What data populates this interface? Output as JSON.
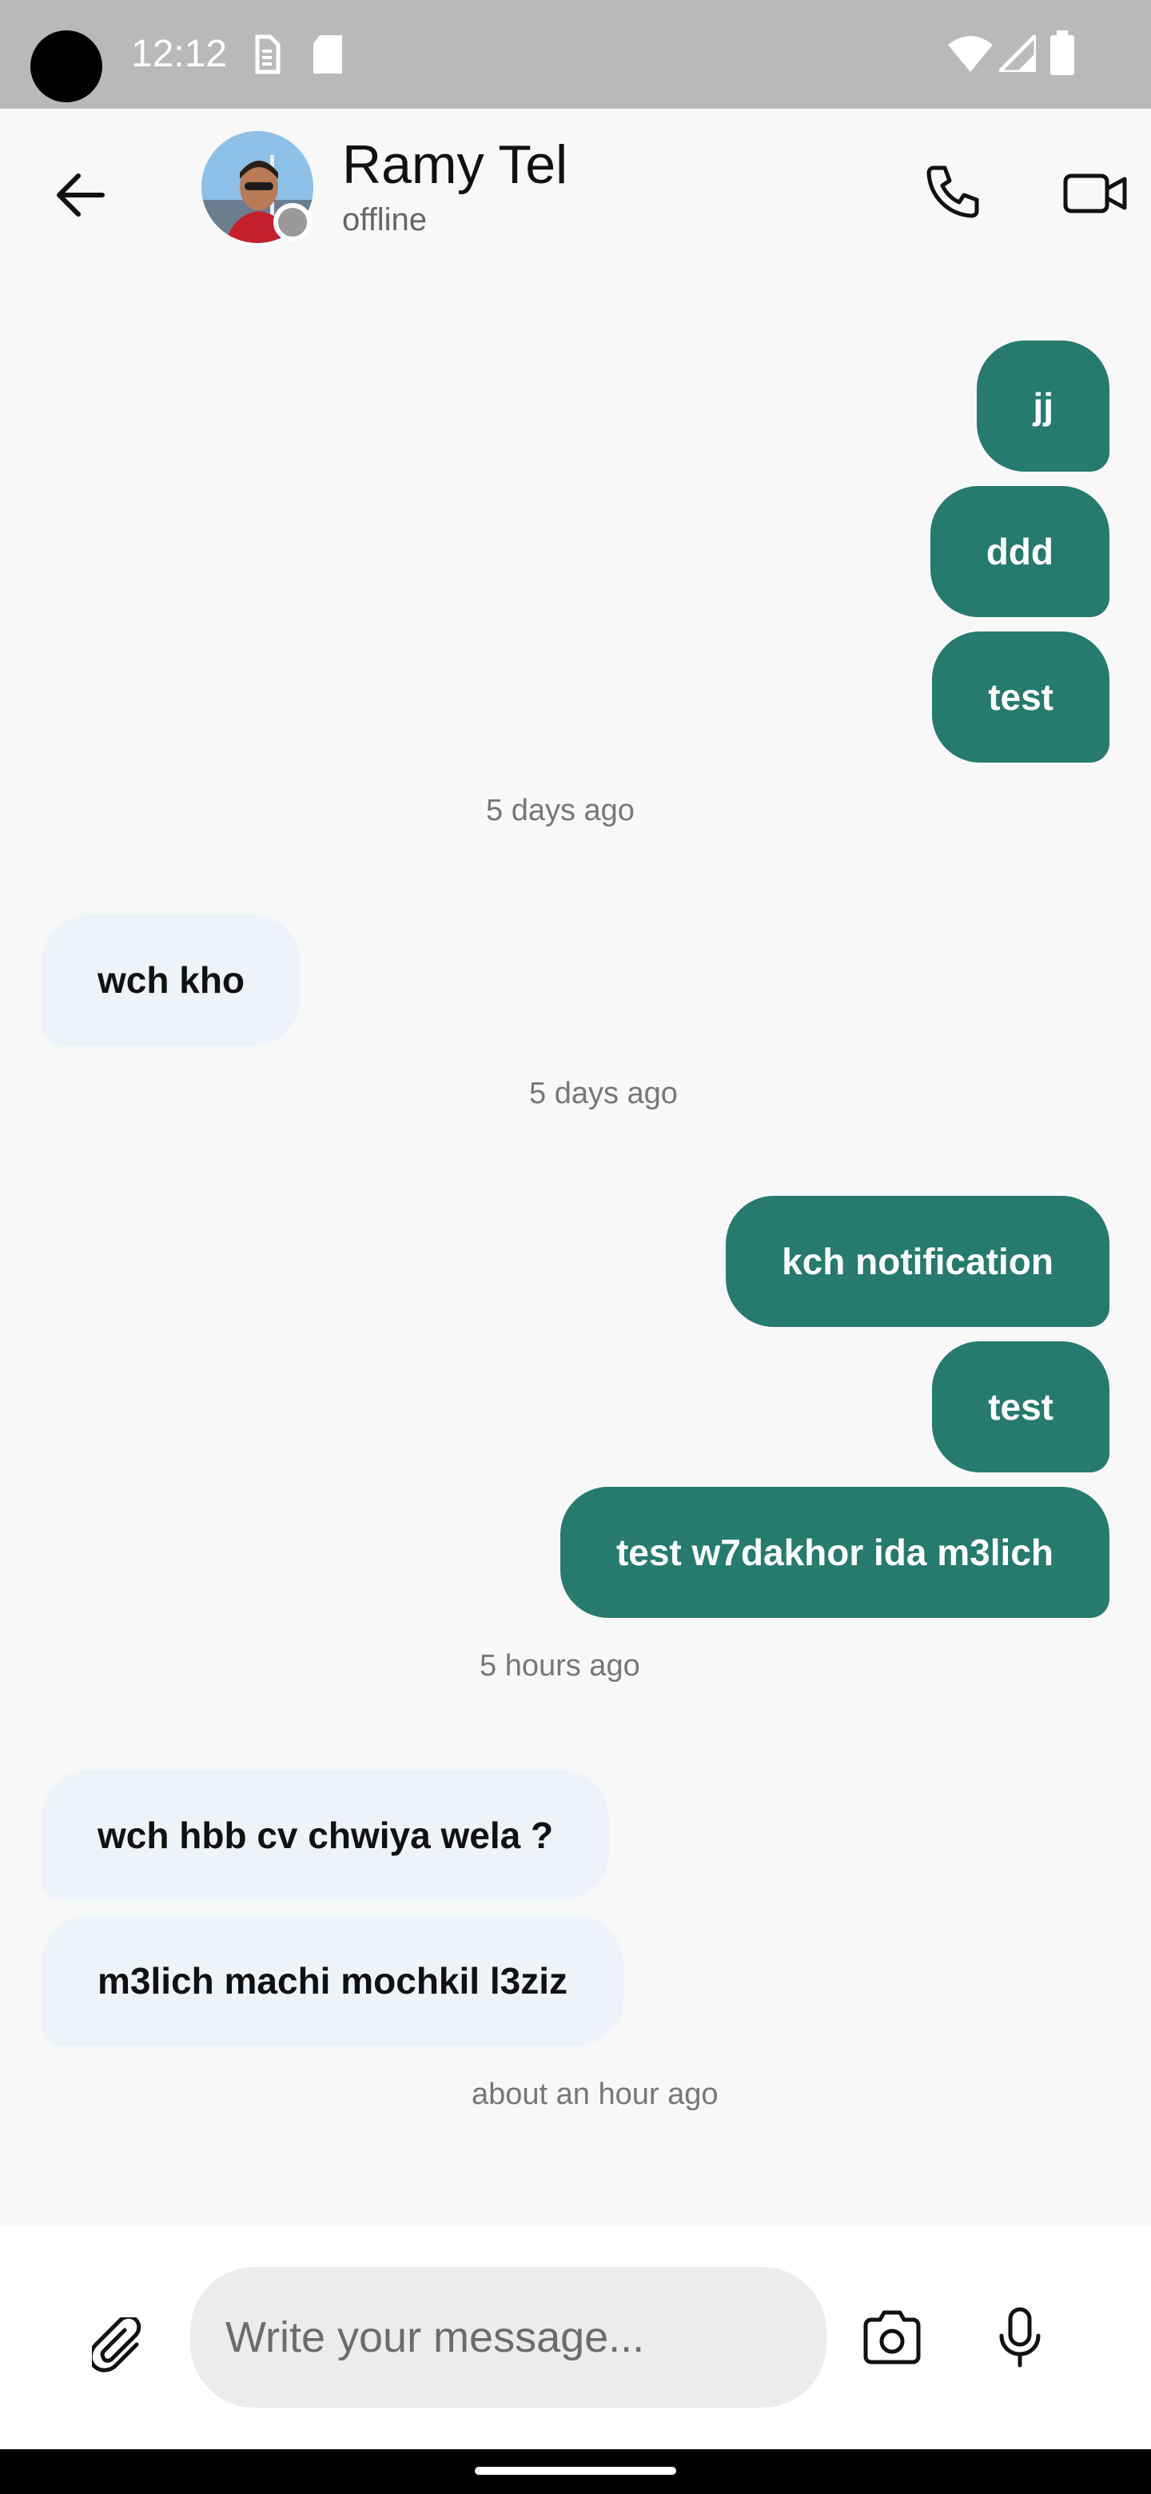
{
  "status_bar": {
    "time": "12:12",
    "icons": [
      "sim-card-icon",
      "sd-card-icon",
      "wifi-icon",
      "cellular-signal-icon",
      "battery-icon"
    ]
  },
  "header": {
    "back_icon": "arrow-left-icon",
    "contact_name": "Ramy Tel",
    "contact_status": "offline",
    "call_icon": "phone-icon",
    "video_icon": "video-camera-icon"
  },
  "messages": [
    {
      "direction": "out",
      "text": "jj"
    },
    {
      "direction": "out",
      "text": "ddd"
    },
    {
      "direction": "out",
      "text": "test"
    },
    {
      "type": "timestamp",
      "text": "5 days ago"
    },
    {
      "direction": "in",
      "text": "wch kho"
    },
    {
      "type": "timestamp",
      "text": "5 days ago"
    },
    {
      "direction": "out",
      "text": "kch notification"
    },
    {
      "direction": "out",
      "text": "test"
    },
    {
      "direction": "out",
      "text": "test w7dakhor ida m3lich"
    },
    {
      "type": "timestamp",
      "text": "5 hours ago"
    },
    {
      "direction": "in",
      "text": "wch hbb cv chwiya wela ?"
    },
    {
      "direction": "in",
      "text": "m3lich machi mochkil l3ziz"
    },
    {
      "type": "timestamp",
      "text": "about an hour ago"
    }
  ],
  "composer": {
    "placeholder": "Write your message...",
    "value": "",
    "attach_icon": "paperclip-icon",
    "camera_icon": "camera-icon",
    "mic_icon": "microphone-icon"
  },
  "colors": {
    "outgoing_bubble": "#267a6e",
    "incoming_bubble": "#eef3f9",
    "status_bar": "#b9b9b9"
  }
}
